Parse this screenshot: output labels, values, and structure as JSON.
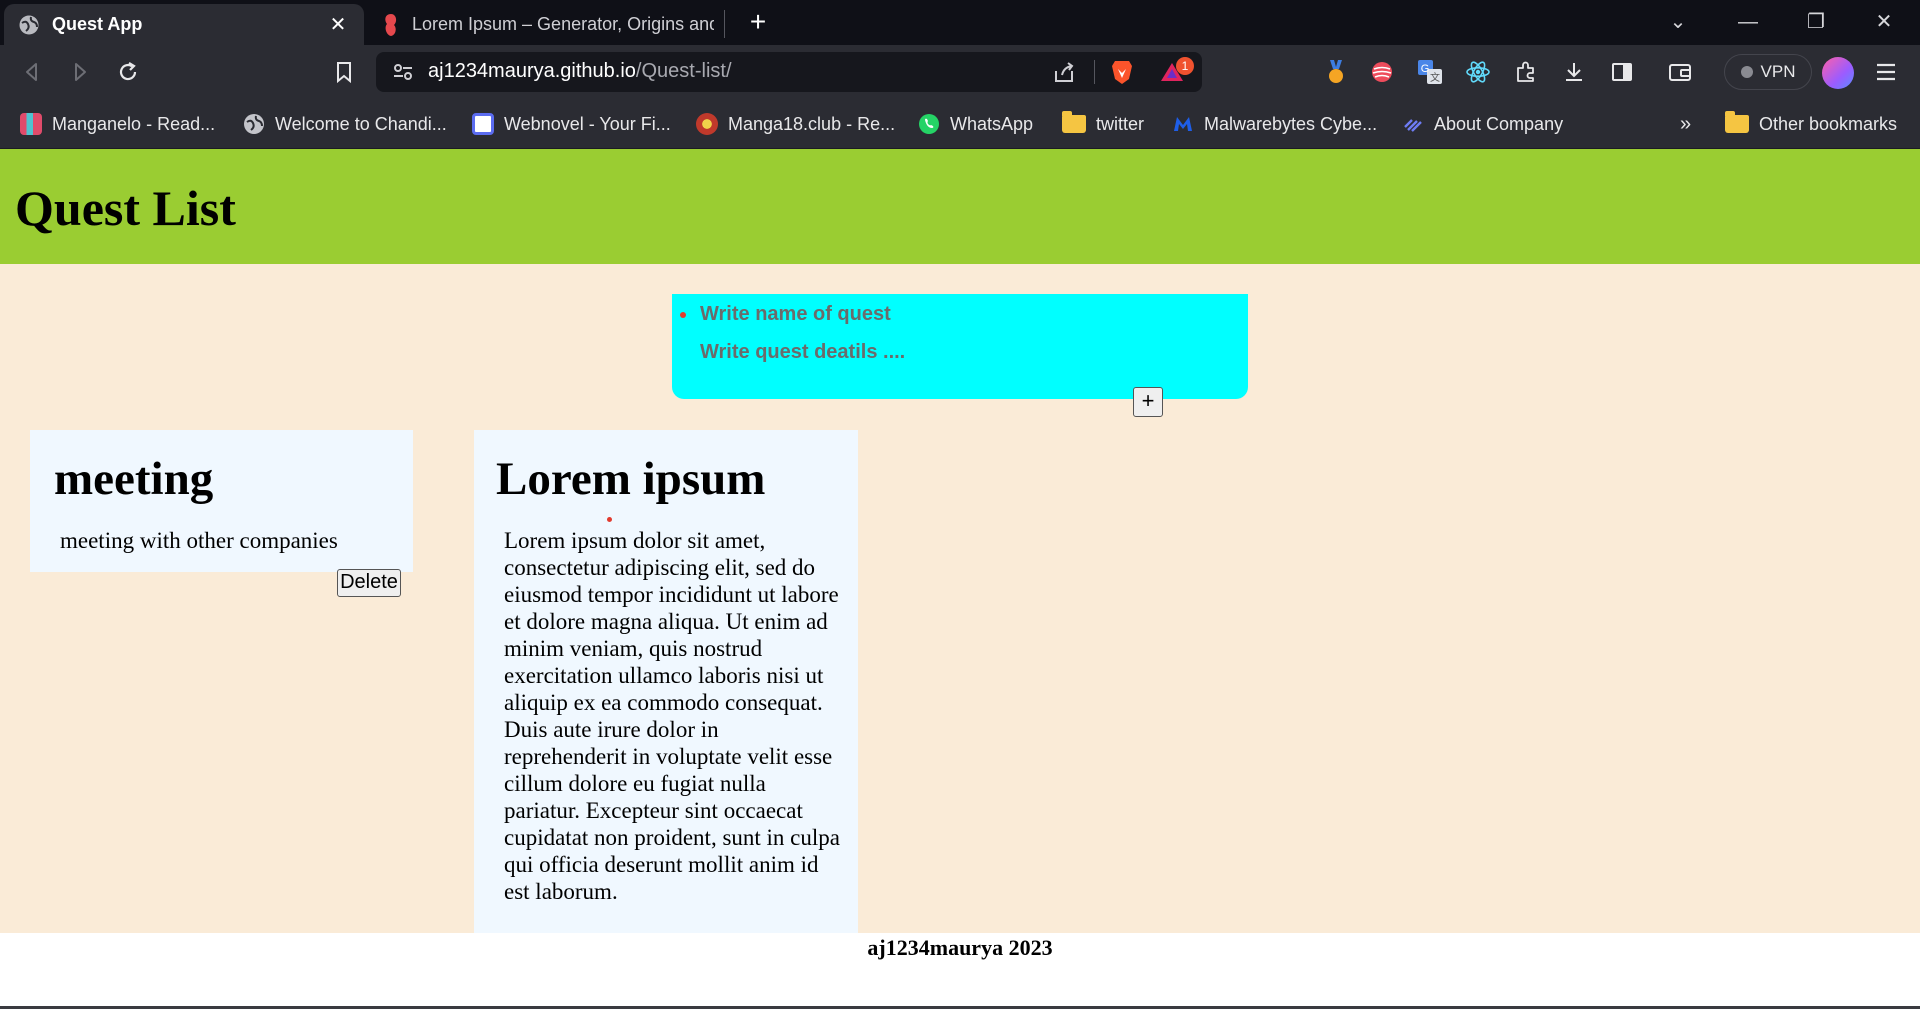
{
  "browser": {
    "tabs": [
      {
        "title": "Quest App",
        "active": true
      },
      {
        "title": "Lorem Ipsum – Generator, Origins and",
        "active": false
      }
    ],
    "url": {
      "host": "aj1234maurya.github.io",
      "path": "/Quest-list/"
    },
    "vpn_label": "VPN",
    "notification_count": "1",
    "bookmarks": [
      "Manganelo - Read...",
      "Welcome to Chandi...",
      "Webnovel - Your Fi...",
      "Manga18.club - Re...",
      "WhatsApp",
      "twitter",
      "Malwarebytes Cybe...",
      "About Company"
    ],
    "more_bookmarks_label": "»",
    "other_bookmarks": "Other bookmarks"
  },
  "app": {
    "title": "Quest List",
    "form": {
      "name_placeholder": "Write name of quest",
      "details_placeholder": "Write quest deatils ....",
      "add_label": "+"
    },
    "quests": [
      {
        "title": "meeting",
        "details": "meeting with other companies",
        "delete_label": "Delete"
      },
      {
        "title": "Lorem ipsum",
        "details": "Lorem ipsum dolor sit amet, consectetur adipiscing elit, sed do eiusmod tempor incididunt ut labore et dolore magna aliqua. Ut enim ad minim veniam, quis nostrud exercitation ullamco laboris nisi ut aliquip ex ea commodo consequat. Duis aute irure dolor in reprehenderit in voluptate velit esse cillum dolore eu fugiat nulla pariatur. Excepteur sint occaecat cupidatat non proident, sunt in culpa qui officia deserunt mollit anim id est laborum."
      }
    ],
    "footer": "aj1234maurya 2023"
  },
  "colors": {
    "header_bg": "#9acd32",
    "page_bg": "#faebd7",
    "form_bg": "#00ffff",
    "card_bg": "#f0f8ff"
  }
}
